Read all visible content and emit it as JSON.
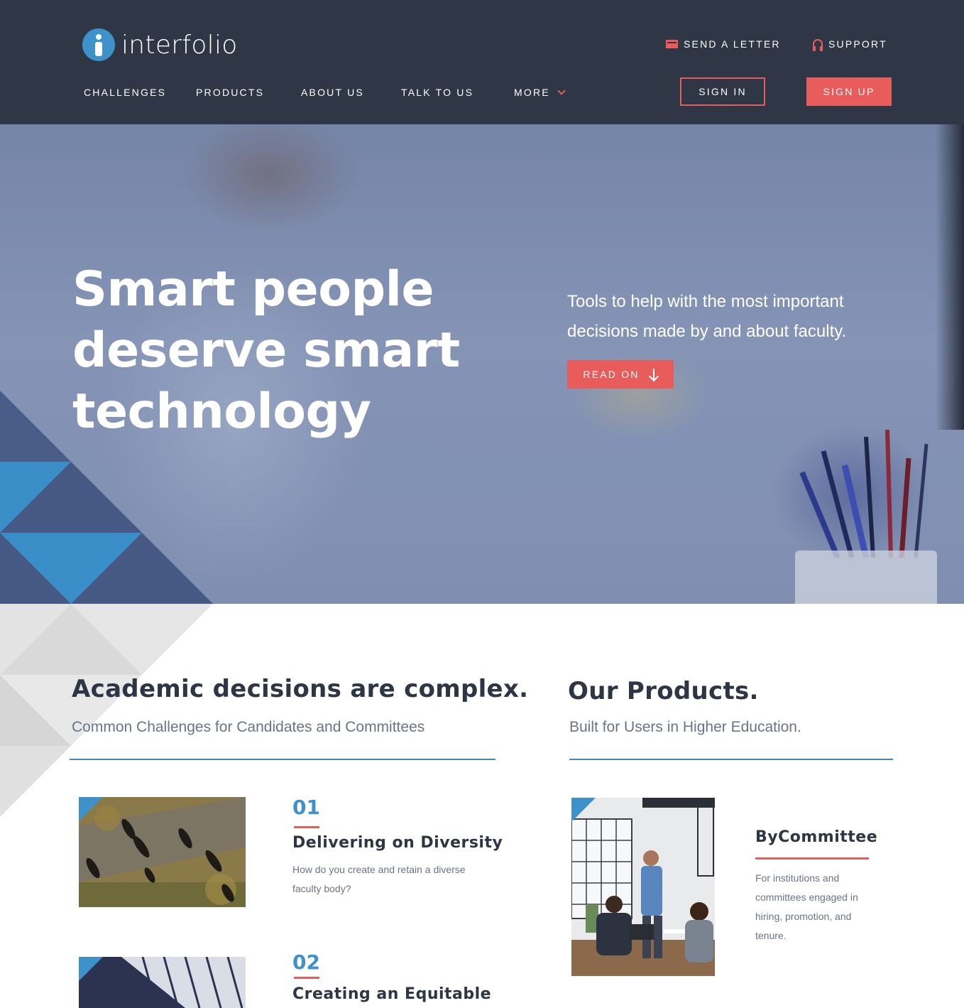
{
  "brand": {
    "name": "interfolio",
    "colors": {
      "navy": "#2f3646",
      "coral": "#e85c5c",
      "blue": "#3d92c9"
    }
  },
  "header": {
    "utility": [
      {
        "label": "SEND A LETTER",
        "icon": "mail-icon"
      },
      {
        "label": "SUPPORT",
        "icon": "headset-icon"
      }
    ],
    "nav": [
      "CHALLENGES",
      "PRODUCTS",
      "ABOUT US",
      "TALK TO US",
      "MORE"
    ],
    "sign_in": "SIGN IN",
    "sign_up": "SIGN UP"
  },
  "hero": {
    "title_lines": [
      "Smart people",
      "deserve smart",
      "technology"
    ],
    "subtitle_lines": [
      "Tools to help with the most important",
      "decisions made by and about faculty."
    ],
    "cta": "READ ON"
  },
  "challenges": {
    "title": "Academic decisions are complex.",
    "subtitle": "Common Challenges for Candidates and Committees",
    "items": [
      {
        "number": "01",
        "title": "Delivering on Diversity",
        "desc_lines": [
          "How do you create and retain a diverse",
          "faculty body?"
        ]
      },
      {
        "number": "02",
        "title": "Creating an Equitable"
      }
    ]
  },
  "products": {
    "title": "Our Products.",
    "subtitle": "Built for Users in Higher Education.",
    "items": [
      {
        "title": "ByCommittee",
        "desc_lines": [
          "For institutions and",
          "committees engaged in",
          "hiring, promotion, and",
          "tenure."
        ]
      }
    ]
  }
}
